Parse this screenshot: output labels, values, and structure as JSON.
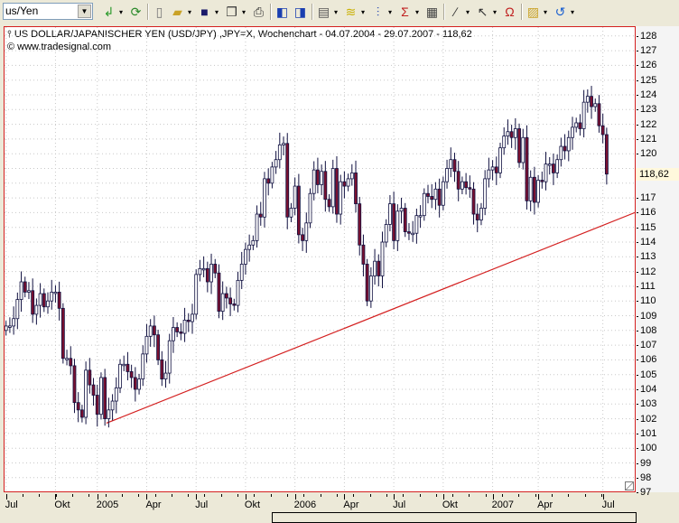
{
  "toolbar": {
    "symbol_value": "us/Yen",
    "buttons": [
      {
        "name": "apply-arrow",
        "glyph": "↲",
        "color": "#2a9a2a",
        "dd": true
      },
      {
        "name": "refresh",
        "glyph": "⟳",
        "color": "#2a8a2a",
        "dd": false
      },
      {
        "name": "new-document",
        "glyph": "▯",
        "color": "#777",
        "dd": false
      },
      {
        "name": "open-folder",
        "glyph": "▰",
        "color": "#c9a227",
        "dd": true
      },
      {
        "name": "save-disk",
        "glyph": "■",
        "color": "#1a1a6a",
        "dd": true
      },
      {
        "name": "copy",
        "glyph": "❐",
        "color": "#333",
        "dd": true
      },
      {
        "name": "print",
        "glyph": "⎙",
        "color": "#333",
        "dd": false
      },
      {
        "name": "chart-back",
        "glyph": "◧",
        "color": "#1a3fb0",
        "dd": false
      },
      {
        "name": "chart-forward",
        "glyph": "◨",
        "color": "#1a3fb0",
        "dd": false
      },
      {
        "name": "window",
        "glyph": "▤",
        "color": "#555",
        "dd": true
      },
      {
        "name": "indicator",
        "glyph": "≋",
        "color": "#c9b000",
        "dd": true
      },
      {
        "name": "strategy",
        "glyph": "⫶",
        "color": "#1a3fb0",
        "dd": true
      },
      {
        "name": "sigma",
        "glyph": "Σ",
        "color": "#c02020",
        "dd": true
      },
      {
        "name": "properties",
        "glyph": "▦",
        "color": "#444",
        "dd": false
      },
      {
        "name": "draw-line",
        "glyph": "∕",
        "color": "#333",
        "dd": true
      },
      {
        "name": "pointer",
        "glyph": "↖",
        "color": "#333",
        "dd": true
      },
      {
        "name": "magnet",
        "glyph": "Ω",
        "color": "#c02020",
        "dd": false
      },
      {
        "name": "help",
        "glyph": "▨",
        "color": "#c9a227",
        "dd": true
      },
      {
        "name": "undo",
        "glyph": "↺",
        "color": "#1a5fd0",
        "dd": true
      }
    ]
  },
  "chart": {
    "title": "US DOLLAR/JAPANISCHER YEN (USD/JPY) ,JPY=X, Wochenchart - 04.07.2004 - 29.07.2007 - 118,62",
    "copyright": "© www.tradesignal.com",
    "last_price_label": "118,62",
    "colors": {
      "up": "#ffffff",
      "down": "#7a1030",
      "outline": "#101040",
      "trendline": "#d42020",
      "border": "#d42020"
    }
  },
  "chart_data": {
    "type": "candlestick",
    "title": "US DOLLAR/JAPANISCHER YEN (USD/JPY) ,JPY=X, Wochenchart",
    "period": "04.07.2004 - 29.07.2007",
    "interval": "weekly",
    "first_open": 108.0,
    "closes": [
      108.3,
      108.3,
      108.8,
      110.1,
      111.3,
      110.6,
      110.7,
      109.1,
      109.7,
      110.5,
      109.6,
      110.0,
      110.6,
      110.6,
      109.5,
      106.1,
      106.1,
      105.6,
      103.1,
      102.6,
      102.1,
      105.3,
      104.3,
      103.6,
      102.3,
      104.8,
      102.0,
      102.6,
      103.2,
      104.1,
      105.7,
      105.7,
      105.2,
      104.8,
      104.0,
      104.7,
      106.4,
      107.6,
      108.3,
      107.7,
      106.0,
      104.7,
      105.1,
      107.3,
      108.2,
      107.9,
      107.8,
      108.7,
      108.6,
      109.1,
      111.8,
      112.2,
      112.2,
      111.3,
      112.5,
      111.9,
      109.3,
      110.5,
      110.2,
      109.8,
      109.7,
      111.4,
      112.5,
      113.5,
      113.8,
      114.1,
      115.9,
      115.7,
      118.3,
      118.0,
      119.1,
      119.6,
      120.6,
      120.7,
      115.7,
      116.3,
      117.8,
      114.5,
      114.1,
      115.3,
      117.3,
      118.9,
      117.9,
      118.8,
      116.9,
      116.4,
      119.0,
      115.9,
      118.1,
      117.8,
      118.3,
      118.7,
      116.6,
      113.8,
      112.5,
      110.0,
      111.7,
      112.7,
      111.7,
      114.0,
      115.2,
      116.6,
      114.1,
      116.1,
      116.3,
      114.7,
      114.6,
      114.6,
      115.8,
      115.8,
      117.3,
      117.1,
      116.9,
      117.6,
      116.5,
      118.1,
      119.0,
      119.6,
      118.8,
      117.6,
      118.1,
      117.7,
      117.6,
      115.9,
      115.5,
      116.3,
      118.3,
      118.9,
      119.1,
      118.7,
      120.4,
      121.2,
      121.5,
      121.1,
      121.7,
      119.4,
      121.1,
      116.8,
      118.4,
      116.7,
      118.2,
      118.1,
      119.3,
      119.3,
      118.7,
      119.6,
      120.5,
      120.2,
      121.1,
      121.8,
      122.1,
      121.7,
      123.5,
      123.9,
      123.2,
      123.4,
      121.9,
      121.3,
      118.62
    ],
    "y_ticks": [
      128,
      127,
      126,
      125,
      124,
      123,
      122,
      121,
      120,
      119,
      118,
      117,
      116,
      115,
      114,
      113,
      112,
      111,
      110,
      109,
      108,
      107,
      106,
      105,
      104,
      103,
      102,
      101,
      100,
      99,
      98,
      97
    ],
    "ylim": [
      97,
      128.6
    ],
    "x_labels": [
      {
        "label": "Jul",
        "week": 0
      },
      {
        "label": "Okt",
        "week": 13
      },
      {
        "label": "2005",
        "week": 24
      },
      {
        "label": "Apr",
        "week": 37
      },
      {
        "label": "Jul",
        "week": 50
      },
      {
        "label": "Okt",
        "week": 63
      },
      {
        "label": "2006",
        "week": 76
      },
      {
        "label": "Apr",
        "week": 89
      },
      {
        "label": "Jul",
        "week": 102
      },
      {
        "label": "Okt",
        "week": 115
      },
      {
        "label": "2007",
        "week": 128
      },
      {
        "label": "Apr",
        "week": 140
      },
      {
        "label": "Jul",
        "week": 157
      }
    ],
    "trendline": {
      "start": {
        "week": 26.4,
        "price": 101.7
      },
      "end": {
        "week": 165.4,
        "price": 116.0
      }
    },
    "last_price": 118.62,
    "grid": true
  }
}
